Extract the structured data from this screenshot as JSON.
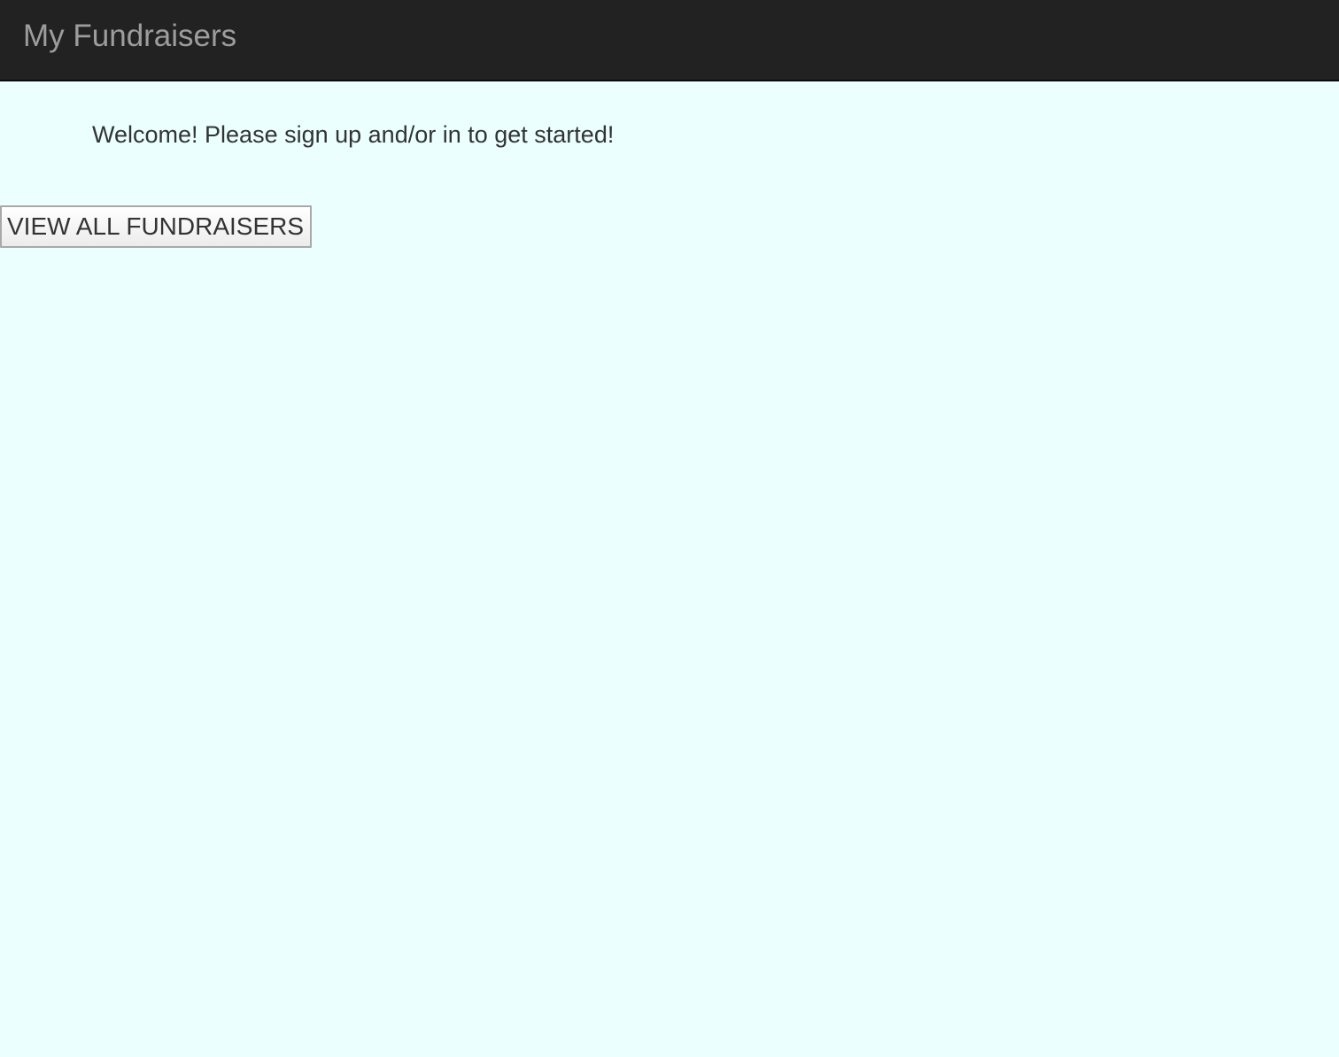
{
  "navbar": {
    "brand": "My Fundraisers",
    "background_color": "#222222",
    "brand_color": "#9d9d9d"
  },
  "main": {
    "welcome_message": "Welcome! Please sign up and/or in to get started!",
    "view_all_button_label": "VIEW ALL FUNDRAISERS",
    "background_color": "#ebffff"
  }
}
